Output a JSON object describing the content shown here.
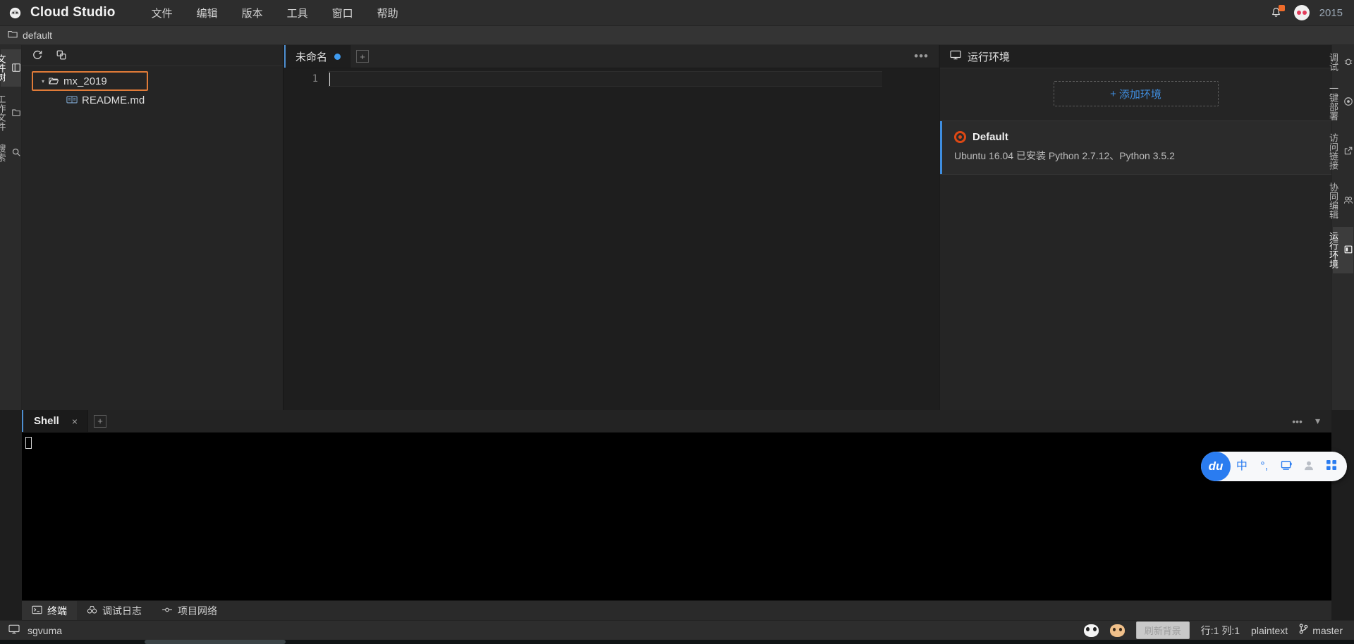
{
  "app": {
    "logo_icon": "dashboard-icon",
    "title": "Cloud Studio",
    "menus": [
      {
        "label": "文件"
      },
      {
        "label": "编辑"
      },
      {
        "label": "版本"
      },
      {
        "label": "工具"
      },
      {
        "label": "窗口"
      },
      {
        "label": "帮助"
      }
    ],
    "notification_icon": "bell-icon",
    "avatar_icon": "avatar-icon",
    "user_name": "2015"
  },
  "breadcrumb": {
    "folder_icon": "folder-icon",
    "path": "default"
  },
  "left_rail": {
    "items": [
      {
        "icon": "file-tree-icon",
        "label": "文件树",
        "active": true
      },
      {
        "icon": "working-files-icon",
        "label": "工作文件",
        "active": false
      },
      {
        "icon": "search-icon",
        "label": "搜索",
        "active": false
      }
    ]
  },
  "file_tree": {
    "toolbar": [
      {
        "icon": "refresh-icon",
        "glyph": "⟳"
      },
      {
        "icon": "collapse-all-icon",
        "glyph": "⧉"
      }
    ],
    "nodes": [
      {
        "caret": "▾",
        "icon": "folder-open-icon",
        "label": "mx_2019",
        "selected": true
      },
      {
        "caret": "",
        "icon": "markdown-file-icon",
        "label": "README.md",
        "selected": false
      }
    ]
  },
  "editor": {
    "tab": {
      "label": "未命名",
      "dirty": true
    },
    "new_tab_glyph": "+",
    "more_glyph": "•••",
    "line_numbers": [
      "1"
    ],
    "content": ""
  },
  "runtime_panel": {
    "header_icon": "monitor-icon",
    "header_title": "运行环境",
    "add_button": {
      "plus": "+",
      "label": "添加环境"
    },
    "environments": [
      {
        "icon": "ubuntu-icon",
        "name": "Default",
        "description": "Ubuntu 16.04 已安装 Python 2.7.12、Python 3.5.2",
        "active": true
      }
    ]
  },
  "right_rail": {
    "items": [
      {
        "icon": "debug-icon",
        "label": "调试",
        "active": false
      },
      {
        "icon": "deploy-icon",
        "label": "一键部署",
        "active": false
      },
      {
        "icon": "link-icon",
        "label": "访问链接",
        "active": false
      },
      {
        "icon": "collaborate-icon",
        "label": "协同编辑",
        "active": false
      },
      {
        "icon": "runtime-env-icon",
        "label": "运行环境",
        "active": true
      }
    ]
  },
  "terminal": {
    "tab_label": "Shell",
    "close_glyph": "×",
    "new_tab_glyph": "+",
    "more_glyph": "•••",
    "chevron_glyph": "▾",
    "content": ""
  },
  "tool_tabs": [
    {
      "icon": "terminal-icon",
      "label": "终端",
      "active": true
    },
    {
      "icon": "debug-log-icon",
      "label": "调试日志",
      "active": false
    },
    {
      "icon": "project-network-icon",
      "label": "项目网络",
      "active": false
    }
  ],
  "status_bar": {
    "left": {
      "icon": "monitor-icon",
      "workspace": "sgvuma"
    },
    "right": {
      "cat_icon": "cat-icon",
      "dog_icon": "dog-icon",
      "refresh_background_label": "刷新背景",
      "cursor_position": "行:1 列:1",
      "language_mode": "plaintext",
      "branch_icon": "git-branch-icon",
      "branch": "master"
    }
  },
  "ime_bar": {
    "logo": "du",
    "icons": [
      {
        "name": "language-mode-icon",
        "glyph": "中",
        "muted": false
      },
      {
        "name": "punctuation-icon",
        "glyph": "°,",
        "muted": false
      },
      {
        "name": "soft-keyboard-icon",
        "glyph": "⌨",
        "muted": false
      },
      {
        "name": "user-icon",
        "glyph": "☻",
        "muted": true
      },
      {
        "name": "apps-grid-icon",
        "glyph": "▦",
        "muted": false
      }
    ]
  },
  "colors": {
    "accent_blue": "#3f8ee0",
    "selection_orange": "#e07b38",
    "ubuntu_orange": "#dd4814",
    "notification_orange": "#ef6c2b",
    "bg_dark": "#1e1e1e",
    "panel_bg": "#252525",
    "menubar_bg": "#2d2d2d",
    "terminal_bg": "#000000"
  }
}
